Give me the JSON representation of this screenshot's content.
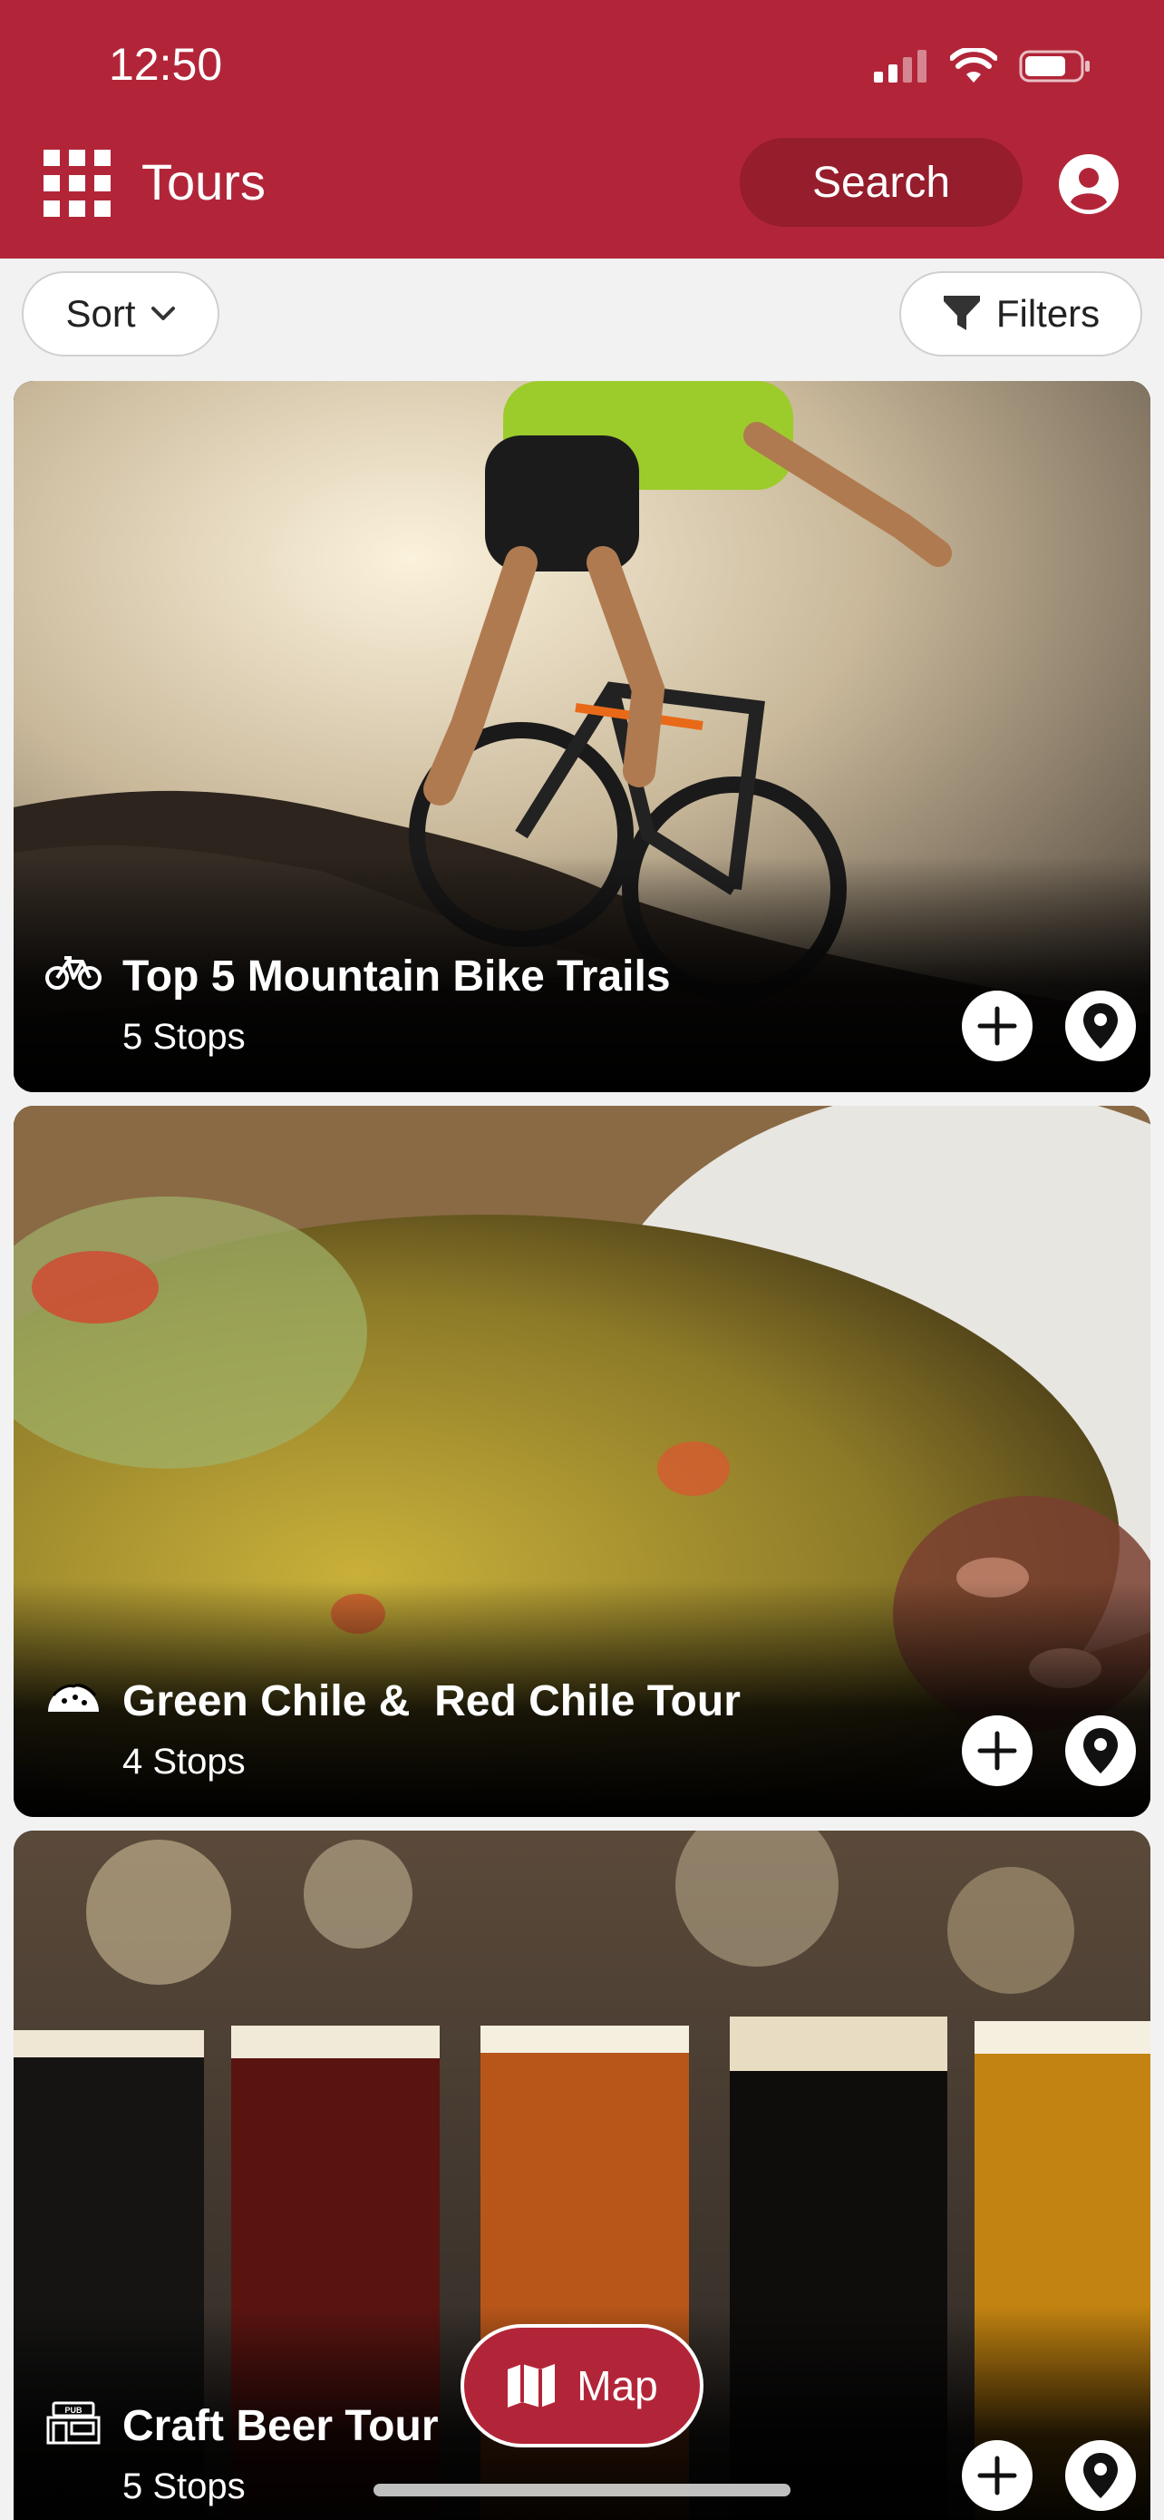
{
  "status_bar": {
    "time": "12:50"
  },
  "app_bar": {
    "title": "Tours",
    "search_label": "Search"
  },
  "toolbar": {
    "sort_label": "Sort",
    "filters_label": "Filters"
  },
  "tours": [
    {
      "title": "Top 5 Mountain Bike Trails",
      "stops": "5 Stops",
      "category_icon": "bicycle-icon"
    },
    {
      "title": "Green Chile &  Red Chile Tour",
      "stops": "4 Stops",
      "category_icon": "taco-icon"
    },
    {
      "title": "Craft Beer Tour",
      "stops": "5 Stops",
      "category_icon": "pub-icon"
    }
  ],
  "map_button": {
    "label": "Map"
  },
  "colors": {
    "brand": "#b22538",
    "brand_dark": "#951d2c"
  }
}
